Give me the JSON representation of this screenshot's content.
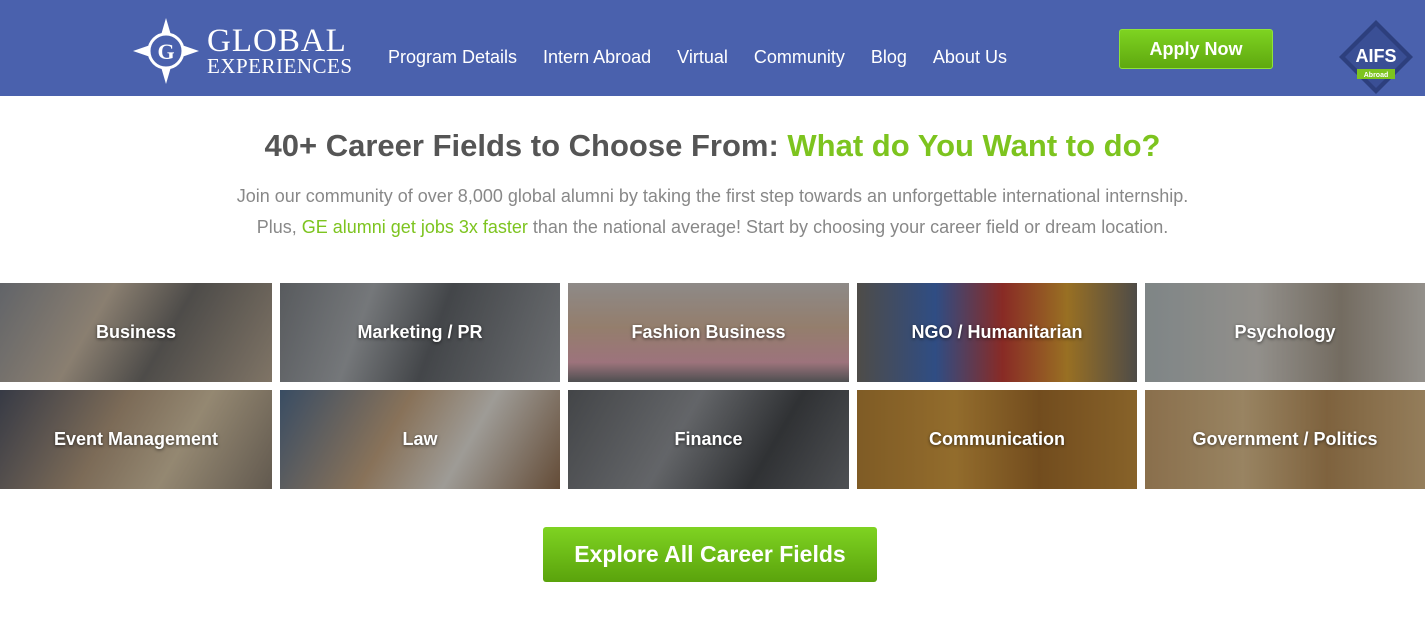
{
  "header": {
    "logo_main": "GLOBAL",
    "logo_sub": "EXPERIENCES",
    "nav": [
      "Program Details",
      "Intern Abroad",
      "Virtual",
      "Community",
      "Blog",
      "About Us"
    ],
    "apply_label": "Apply Now",
    "badge_main": "AIFS",
    "badge_sub": "Abroad",
    "colors": {
      "bar": "#4a61ad",
      "accent": "#7dc41f"
    }
  },
  "intro": {
    "title_plain": "40+ Career Fields to Choose From: ",
    "title_accent": "What do You Want to do?",
    "line1": "Join our community of over 8,000 global alumni by taking the first step towards an unforgettable international internship.",
    "line2_prefix": "Plus, ",
    "line2_link": "GE alumni get jobs 3x faster",
    "line2_suffix": " than the national average! Start by choosing your career field or dream location."
  },
  "fields": [
    {
      "label": "Business"
    },
    {
      "label": "Marketing / PR"
    },
    {
      "label": "Fashion Business"
    },
    {
      "label": "NGO / Humanitarian"
    },
    {
      "label": "Psychology"
    },
    {
      "label": "Event Management"
    },
    {
      "label": "Law"
    },
    {
      "label": "Finance"
    },
    {
      "label": "Communication"
    },
    {
      "label": "Government / Politics"
    }
  ],
  "cta": {
    "label": "Explore All Career Fields"
  }
}
